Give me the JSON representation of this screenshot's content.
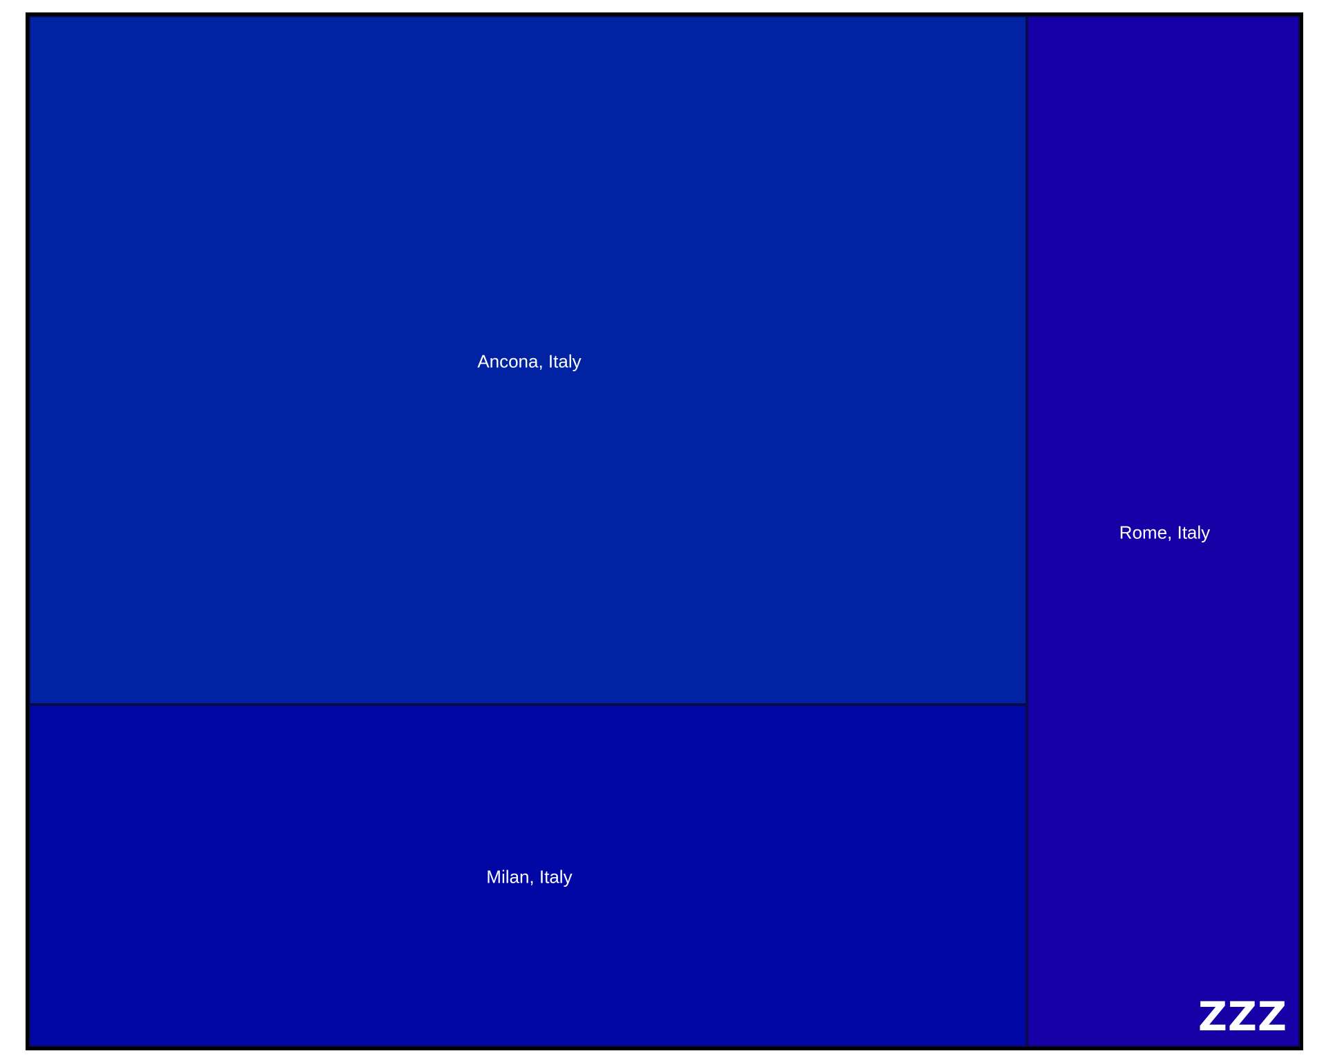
{
  "chart_data": {
    "type": "treemap",
    "title": "",
    "items": [
      {
        "label": "Ancona, Italy",
        "value": 66.2,
        "color": "#0022a3"
      },
      {
        "label": "Milan, Italy",
        "value": 32.9,
        "color": "#0007a4"
      },
      {
        "label": "Rome, Italy",
        "value": 27.1,
        "color": "#1600a6"
      }
    ],
    "border_color": "#000000",
    "label_color": "#ffffff"
  },
  "watermark": {
    "text": "ZZZ"
  }
}
